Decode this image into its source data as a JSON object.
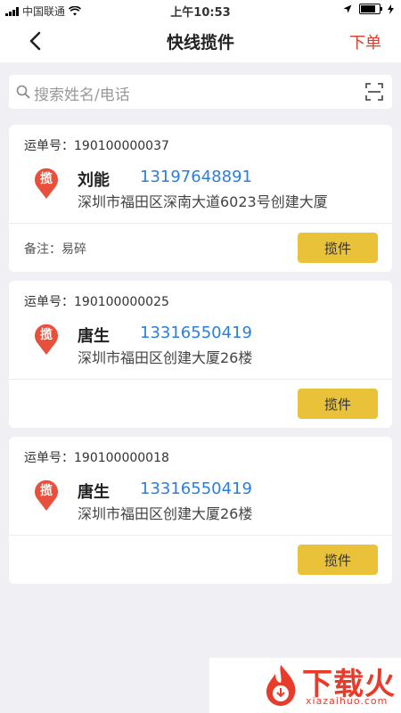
{
  "status": {
    "carrier": "中国联通",
    "time": "上午10:53"
  },
  "nav": {
    "title": "快线揽件",
    "order_label": "下单"
  },
  "search": {
    "placeholder": "搜索姓名/电话"
  },
  "cards": [
    {
      "waybill": "运单号：190100000037",
      "badge": "揽",
      "name": "刘能",
      "phone": "13197648891",
      "address": "深圳市福田区深南大道6023号创建大厦",
      "remark": "备注：易碎",
      "action": "揽件"
    },
    {
      "waybill": "运单号：190100000025",
      "badge": "揽",
      "name": "唐生",
      "phone": "13316550419",
      "address": "深圳市福田区创建大厦26楼",
      "remark": "",
      "action": "揽件"
    },
    {
      "waybill": "运单号：190100000018",
      "badge": "揽",
      "name": "唐生",
      "phone": "13316550419",
      "address": "深圳市福田区创建大厦26楼",
      "remark": "",
      "action": "揽件"
    }
  ],
  "watermark": {
    "main": "下载火",
    "sub": "xiazaihuo.com"
  },
  "colors": {
    "accent_red": "#e03c2b",
    "phone_blue": "#2b7de1",
    "button_yellow": "#e9c23a",
    "badge_red": "#e8503c"
  }
}
